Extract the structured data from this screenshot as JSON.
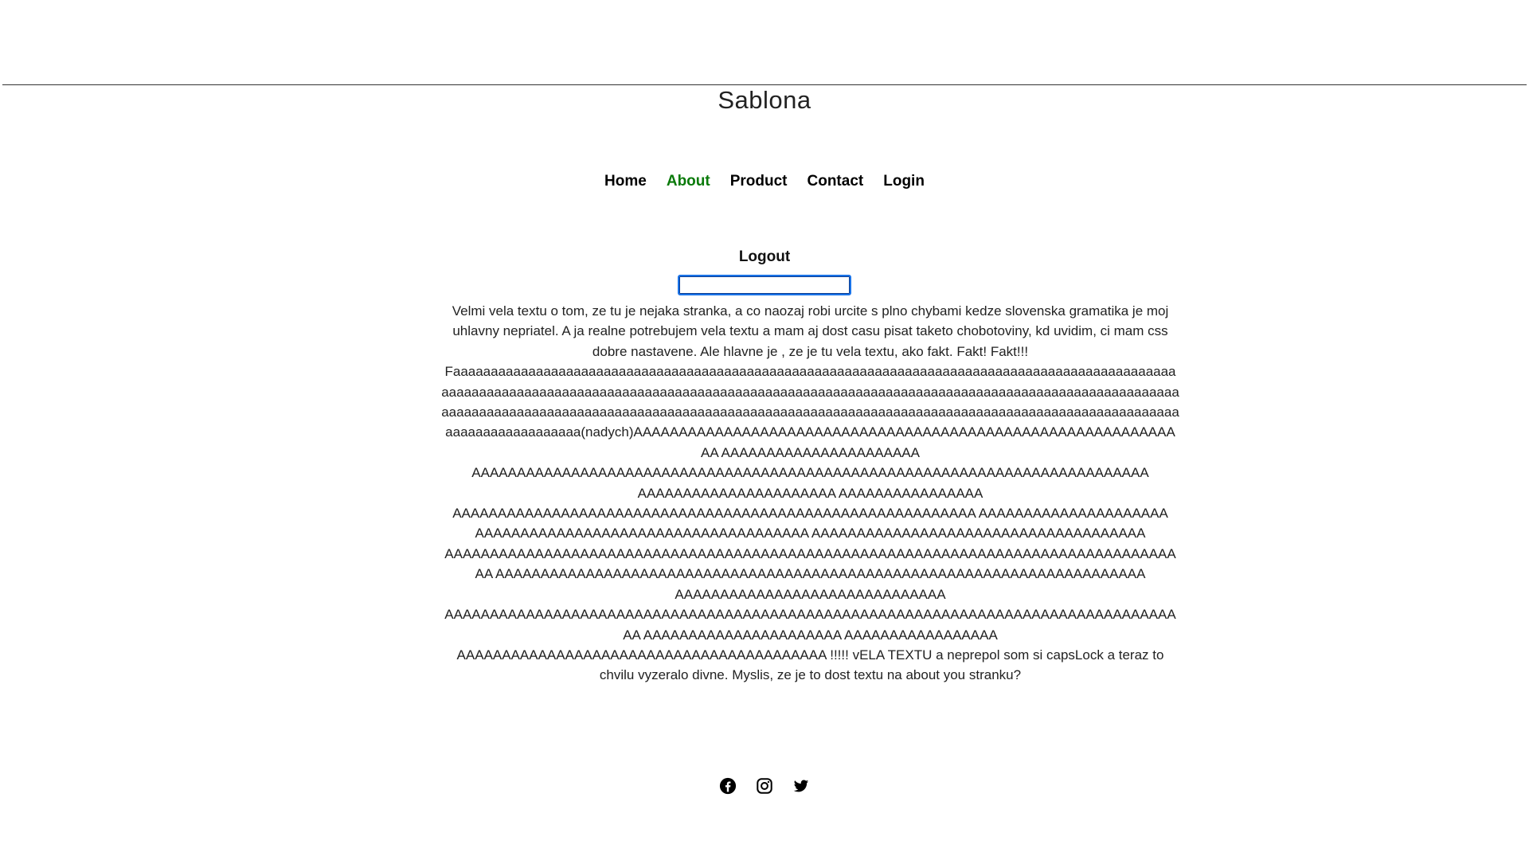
{
  "header": {
    "site_title": "Sablona"
  },
  "nav": {
    "items": [
      {
        "label": "Home",
        "active": false
      },
      {
        "label": "About",
        "active": true
      },
      {
        "label": "Product",
        "active": false
      },
      {
        "label": "Contact",
        "active": false
      },
      {
        "label": "Login",
        "active": false
      }
    ],
    "active_color": "#0a7a0a"
  },
  "logout": {
    "label": "Logout"
  },
  "search": {
    "value": "",
    "placeholder": ""
  },
  "main": {
    "about_text": "Velmi vela textu o tom, ze tu je nejaka stranka, a co naozaj robi urcite s plno chybami kedze slovenska gramatika je moj uhlavny nepriatel. A ja realne potrebujem vela textu a mam aj dost casu pisat taketo chobotoviny, kd uvidim, ci mam css dobre nastavene. Ale hlavne je , ze je tu vela textu, ako fakt. Fakt! Fakt!!! Faaaaaaaaaaaaaaaaaaaaaaaaaaaaaaaaaaaaaaaaaaaaaaaaaaaaaaaaaaaaaaaaaaaaaaaaaaaaaaaaaaaaaaaaaaaaaaaaaaaaaaaaaaaaaaaaaaaaaaaaaaaaaaaaaaaaaaaaaaaaaaaaaaaaaaaaaaaaaaaaaaaaaaaaaaaaaaaaaaaaaaaaaaaaaaaaaaaaaaaaaaaaaaaaaaaaaaaaaaaaaaaaaaaaaaaaaaaaaaaaaaaaaaaaaaaaaaaaaaaaaaaaaaaaaaaaaaaaaaaaaaaaaaaaaaaaaaaaaaaaaaaaaaaaaa(nadych)AAAAAAAAAAAAAAAAAAAAAAAAAAAAAAAAAAAAAAAAAAAAAAAAAAAAAAAAAAAAAA AAAAAAAAAAAAAAAAAAAAAA AAAAAAAAAAAAAAAAAAAAAAAAAAAAAAAAAAAAAAAAAAAAAAAAAAAAAAAAAAAAAAAAAAAAAAAAAAA AAAAAAAAAAAAAAAAAAAAAA AAAAAAAAAAAAAAAA AAAAAAAAAAAAAAAAAAAAAAAAAAAAAAAAAAAAAAAAAAAAAAAAAAAAAAAAAA AAAAAAAAAAAAAAAAAAAAA AAAAAAAAAAAAAAAAAAAAAAAAAAAAAAAAAAAAA AAAAAAAAAAAAAAAAAAAAAAAAAAAAAAAAAAAAA AAAAAAAAAAAAAAAAAAAAAAAAAAAAAAAAAAAAAAAAAAAAAAAAAAAAAAAAAAAAAAAAAAAAAAAAAAAAAAAAAAA AAAAAAAAAAAAAAAAAAAAAAAAAAAAAAAAAAAAAAAAAAAAAAAAAAAAAAAAAAAAAAAAAAAAAAAA AAAAAAAAAAAAAAAAAAAAAAAAAAAAAA AAAAAAAAAAAAAAAAAAAAAAAAAAAAAAAAAAAAAAAAAAAAAAAAAAAAAAAAAAAAAAAAAAAAAAAAAAAAAAAAAAA AAAAAAAAAAAAAAAAAAAAAA AAAAAAAAAAAAAAAAA AAAAAAAAAAAAAAAAAAAAAAAAAAAAAAAAAAAAAAAAA !!!!! vELA TEXTU a neprepol som si capsLock a teraz to chvilu vyzeralo divne. Myslis, ze je to dost textu na about you stranku?"
  },
  "footer": {
    "social": [
      {
        "icon": "facebook-icon"
      },
      {
        "icon": "instagram-icon"
      },
      {
        "icon": "twitter-icon"
      }
    ]
  }
}
